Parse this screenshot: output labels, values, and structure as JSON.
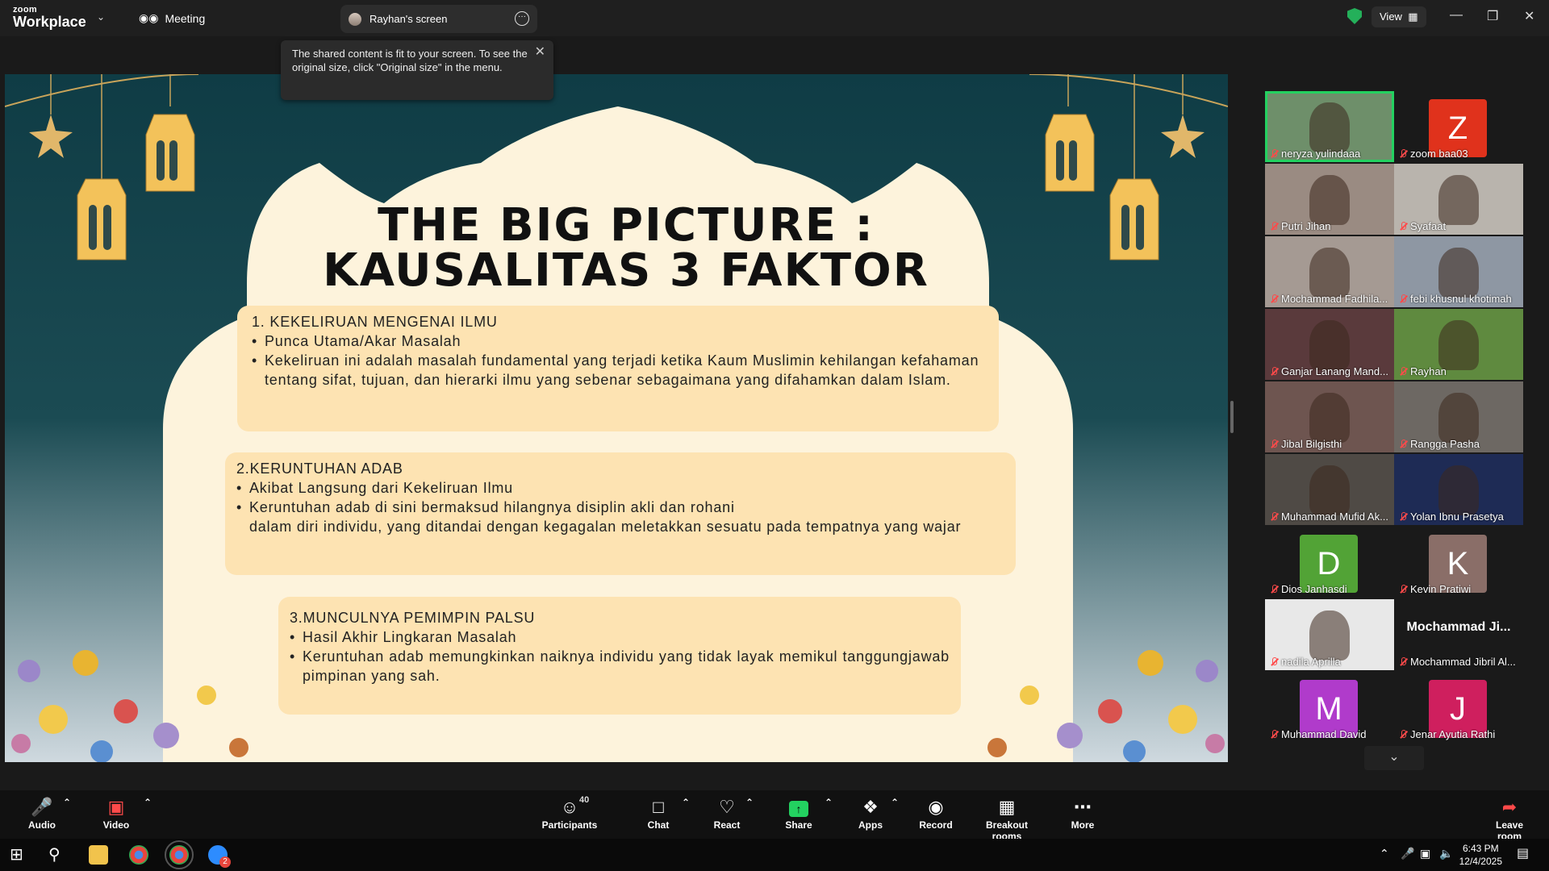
{
  "titlebar": {
    "brand_top": "zoom",
    "brand_bottom": "Workplace",
    "meeting_label": "Meeting",
    "screen_tab_label": "Rayhan's screen",
    "view_label": "View"
  },
  "tooltip": {
    "text": "The shared content is fit to your screen. To see the original size, click \"Original size\" in the menu."
  },
  "slide": {
    "title_line1": "THE BIG PICTURE :",
    "title_line2": "KAUSALITAS 3 FAKTOR",
    "section1": {
      "heading": "1.  KEKELIRUAN MENGENAI ILMU",
      "bullet1": "Punca Utama/Akar Masalah",
      "bullet2": "Kekeliruan ini adalah masalah fundamental yang terjadi ketika Kaum Muslimin kehilangan kefahaman tentang sifat, tujuan, dan hierarki ilmu yang sebenar sebagaimana yang difahamkan dalam Islam."
    },
    "section2": {
      "heading": "2.KERUNTUHAN ADAB",
      "bullet1": "Akibat Langsung dari Kekeliruan Ilmu",
      "bullet2": "Keruntuhan adab di sini bermaksud hilangnya disiplin akli dan rohani",
      "continuation": "dalam diri individu, yang ditandai dengan kegagalan meletakkan sesuatu pada tempatnya yang wajar"
    },
    "section3": {
      "heading": "3.MUNCULNYA PEMIMPIN PALSU",
      "bullet1": "Hasil Akhir Lingkaran Masalah",
      "bullet2": "Keruntuhan adab memungkinkan naiknya individu yang tidak layak memikul tanggungjawab pimpinan yang sah."
    }
  },
  "participants": [
    {
      "name": "neryza yulindaaa",
      "type": "video",
      "bg": "#6e8f6a",
      "active": true
    },
    {
      "name": "zoom baa03",
      "type": "avatar",
      "letter": "Z",
      "color": "#e0321c"
    },
    {
      "name": "Putri Jihan",
      "type": "video",
      "bg": "#9a8b82"
    },
    {
      "name": "Syafaat",
      "type": "video",
      "bg": "#b9b4ad"
    },
    {
      "name": "Mochammad Fadhila...",
      "type": "video",
      "bg": "#a59a93"
    },
    {
      "name": "febi khusnul khotimah",
      "type": "video",
      "bg": "#8e97a3"
    },
    {
      "name": "Ganjar Lanang Mand...",
      "type": "video",
      "bg": "#5a3a3c"
    },
    {
      "name": "Rayhan",
      "type": "video",
      "bg": "#5f8a3f"
    },
    {
      "name": "Jibal Bilgisthi",
      "type": "video",
      "bg": "#6e5550"
    },
    {
      "name": "Rangga Pasha",
      "type": "video",
      "bg": "#6d6863"
    },
    {
      "name": "Muhammad Mufid Ak...",
      "type": "video",
      "bg": "#4f4a45"
    },
    {
      "name": "Yolan Ibnu Prasetya",
      "type": "video",
      "bg": "#1e2b55"
    },
    {
      "name": "Dios Janhasdi",
      "type": "avatar",
      "letter": "D",
      "color": "#52a336"
    },
    {
      "name": "Kevin Pratiwi",
      "type": "avatar",
      "letter": "K",
      "color": "#8a6e68"
    },
    {
      "name": "nadila Aprilla",
      "type": "image",
      "bg": "#e8e8e8"
    },
    {
      "name": "Mochammad Jibril Al...",
      "type": "nametile",
      "display": "Mochammad  Ji..."
    },
    {
      "name": "Muhammad David",
      "type": "avatar",
      "letter": "M",
      "color": "#b03bcb"
    },
    {
      "name": "Jenar Ayutia Rathi",
      "type": "avatar",
      "letter": "J",
      "color": "#cf1f5e"
    }
  ],
  "toolbar": {
    "audio": "Audio",
    "video": "Video",
    "participants": "Participants",
    "participants_count": "40",
    "chat": "Chat",
    "react": "React",
    "share": "Share",
    "apps": "Apps",
    "record": "Record",
    "breakout": "Breakout rooms",
    "more": "More",
    "leave": "Leave room"
  },
  "taskbar": {
    "time": "6:43 PM",
    "date": "12/4/2025",
    "zoom_badge": "2"
  }
}
